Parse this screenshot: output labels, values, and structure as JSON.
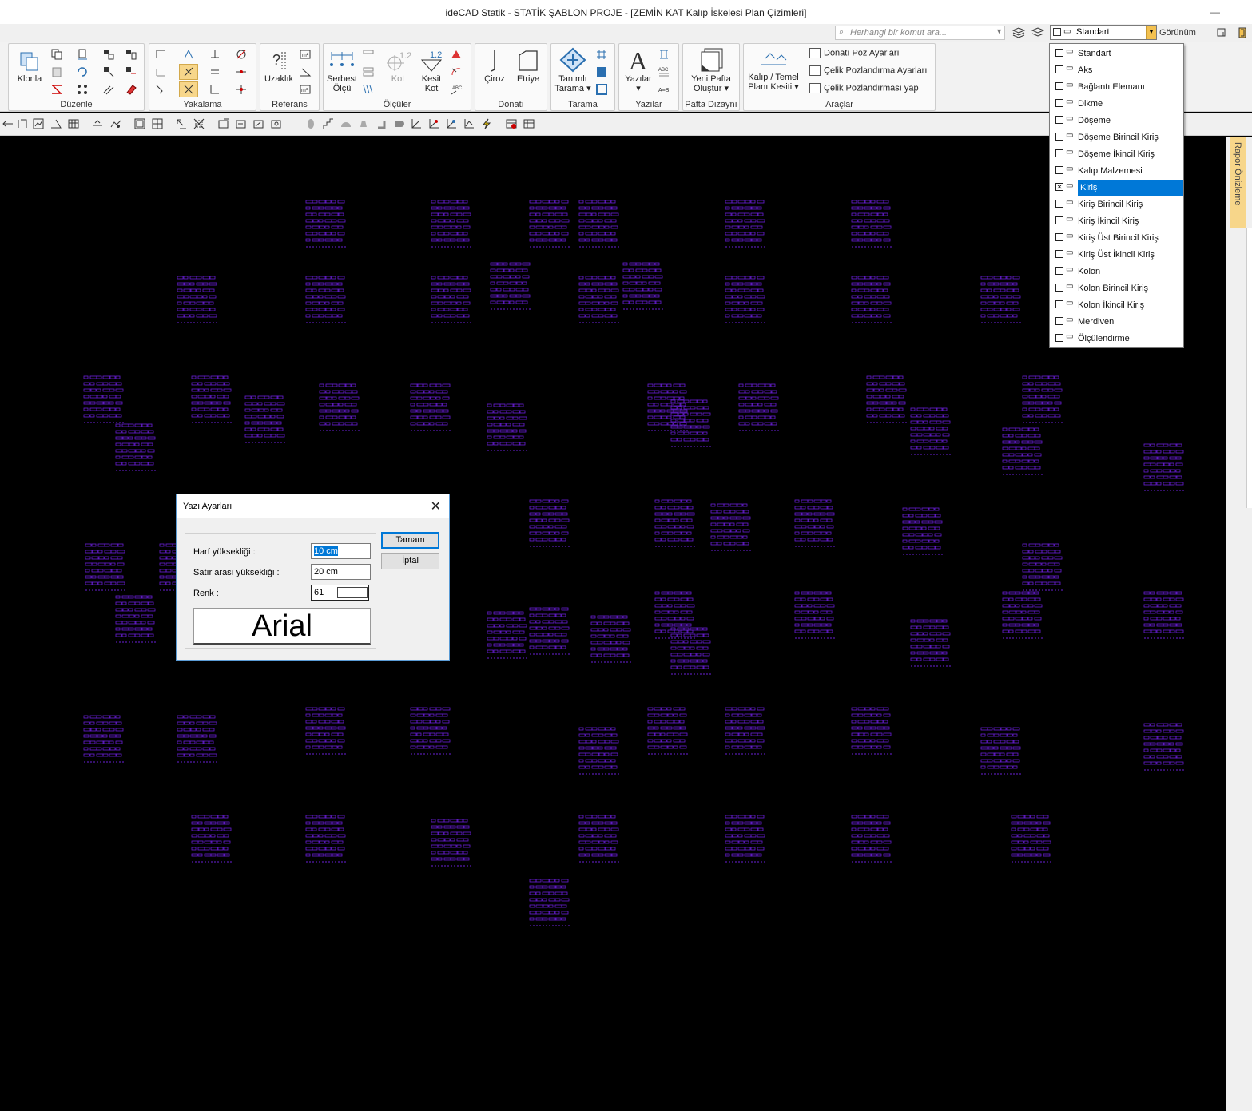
{
  "window": {
    "title": "ideCAD Statik - STATİK ŞABLON PROJE - [ZEMİN KAT Kalıp İskelesi Plan Çizimleri]",
    "minimize": "—"
  },
  "search": {
    "placeholder": "Herhangi bir komut ara..."
  },
  "style_combo": {
    "value": "Standart"
  },
  "view_label": "Görünüm",
  "ribbon": {
    "groups": [
      {
        "label": "Düzenle"
      },
      {
        "label": "Yakalama"
      },
      {
        "label": "Referans"
      },
      {
        "label": "Ölçüler"
      },
      {
        "label": "Donatı"
      },
      {
        "label": "Tarama"
      },
      {
        "label": "Yazılar"
      },
      {
        "label": "Pafta Dizaynı"
      },
      {
        "label": "Araçlar"
      }
    ],
    "buttons": {
      "klonla": "Klonla",
      "uzaklik": "Uzaklık",
      "serbest_olcu_1": "Serbest",
      "serbest_olcu_2": "Ölçü",
      "kot": "Kot",
      "kesit_kot_1": "Kesit",
      "kesit_kot_2": "Kot",
      "ciroz": "Çiroz",
      "etriye": "Etriye",
      "tanimli_tarama_1": "Tanımlı",
      "tanimli_tarama_2": "Tarama",
      "yazilar": "Yazılar",
      "yeni_pafta_1": "Yeni Pafta",
      "yeni_pafta_2": "Oluştur",
      "kalip_temel_1": "Kalıp / Temel",
      "kalip_temel_2": "Planı Kesiti",
      "kot_value": "1.2",
      "kesit_kot_value": "1.2"
    },
    "araclar_items": [
      "Donatı Poz Ayarları",
      "Çelik Pozlandırma Ayarları",
      "Çelik Pozlandırması yap"
    ]
  },
  "side_panel": {
    "label": "Rapor Önizleme"
  },
  "dropdown": {
    "items": [
      {
        "label": "Standart",
        "checked": false,
        "selected": false
      },
      {
        "label": "Aks",
        "checked": false,
        "selected": false
      },
      {
        "label": "Bağlantı Elemanı",
        "checked": false,
        "selected": false
      },
      {
        "label": "Dikme",
        "checked": false,
        "selected": false
      },
      {
        "label": "Döşeme",
        "checked": false,
        "selected": false
      },
      {
        "label": "Döşeme Birincil Kiriş",
        "checked": false,
        "selected": false
      },
      {
        "label": "Döşeme İkincil Kiriş",
        "checked": false,
        "selected": false
      },
      {
        "label": "Kalıp Malzemesi",
        "checked": false,
        "selected": false
      },
      {
        "label": "Kiriş",
        "checked": true,
        "selected": true
      },
      {
        "label": "Kiriş Birincil Kiriş",
        "checked": false,
        "selected": false
      },
      {
        "label": "Kiriş İkincil Kiriş",
        "checked": false,
        "selected": false
      },
      {
        "label": "Kiriş Üst Birincil Kiriş",
        "checked": false,
        "selected": false
      },
      {
        "label": "Kiriş Üst İkincil Kiriş",
        "checked": false,
        "selected": false
      },
      {
        "label": "Kolon",
        "checked": false,
        "selected": false
      },
      {
        "label": "Kolon Birincil Kiriş",
        "checked": false,
        "selected": false
      },
      {
        "label": "Kolon İkincil Kiriş",
        "checked": false,
        "selected": false
      },
      {
        "label": "Merdiven",
        "checked": false,
        "selected": false
      },
      {
        "label": "Ölçülendirme",
        "checked": false,
        "selected": false
      }
    ]
  },
  "dialog": {
    "title": "Yazı Ayarları",
    "close": "✕",
    "harf_label": "Harf yüksekliği :",
    "harf_value": "10 cm",
    "satir_label": "Satır arası yüksekliği :",
    "satir_value": "20 cm",
    "renk_label": "Renk :",
    "renk_value": "61",
    "font_name": "Arial",
    "ok": "Tamam",
    "cancel": "İptal"
  },
  "colors": {
    "drawing": "#6a1fd6",
    "selection": "#0078d7",
    "accent": "#f3c150"
  }
}
